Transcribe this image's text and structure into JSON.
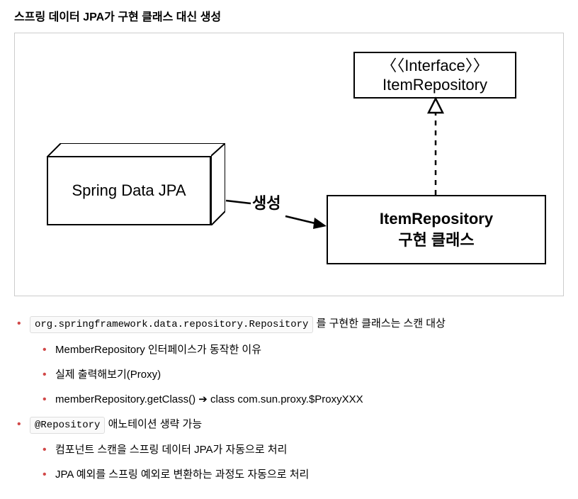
{
  "title": "스프링 데이터 JPA가 구현 클래스 대신 생성",
  "diagram": {
    "interface_stereotype": "〈〈Interface〉〉",
    "interface_name": "ItemRepository",
    "spring_box": "Spring Data JPA",
    "create_label": "생성",
    "impl_line1": "ItemRepository",
    "impl_line2": "구현 클래스"
  },
  "bullets": [
    {
      "code": "org.springframework.data.repository.Repository",
      "text_after": " 를 구현한 클래스는 스캔 대상",
      "children": [
        {
          "text": "MemberRepository 인터페이스가 동작한 이유"
        },
        {
          "text": "실제 출력해보기(Proxy)"
        },
        {
          "text": "memberRepository.getClass() ➔ class com.sun.proxy.$ProxyXXX"
        }
      ]
    },
    {
      "code": "@Repository",
      "text_after": " 애노테이션 생략 가능",
      "children": [
        {
          "text": "컴포넌트 스캔을 스프링 데이터 JPA가 자동으로 처리"
        },
        {
          "text": "JPA 예외를 스프링 예외로 변환하는 과정도 자동으로 처리"
        }
      ]
    }
  ]
}
